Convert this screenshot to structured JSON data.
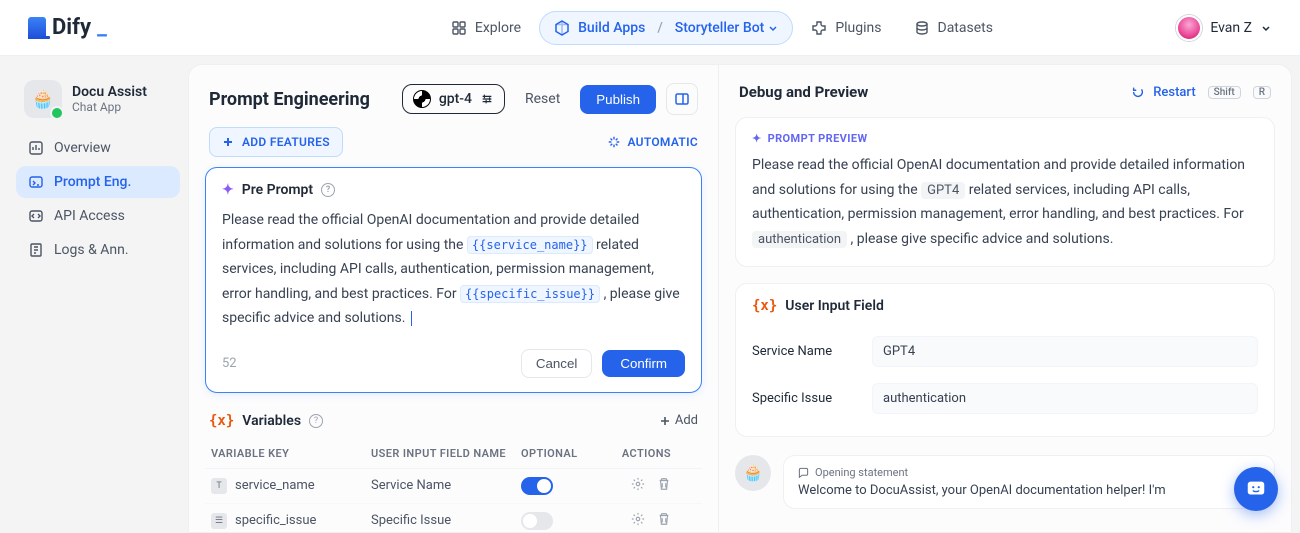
{
  "brand": "Dify",
  "nav": {
    "explore": "Explore",
    "build": "Build Apps",
    "bot": "Storyteller Bot",
    "plugins": "Plugins",
    "datasets": "Datasets"
  },
  "user": {
    "name": "Evan Z"
  },
  "app": {
    "name": "Docu Assist",
    "type": "Chat App",
    "emoji": "🧁"
  },
  "sidebar": {
    "items": [
      {
        "label": "Overview"
      },
      {
        "label": "Prompt Eng."
      },
      {
        "label": "API Access"
      },
      {
        "label": "Logs & Ann."
      }
    ]
  },
  "page": {
    "title": "Prompt Engineering",
    "model": "gpt-4",
    "reset": "Reset",
    "publish": "Publish"
  },
  "features": {
    "add": "ADD FEATURES",
    "auto": "AUTOMATIC"
  },
  "preprompt": {
    "title": "Pre Prompt",
    "text_a": "Please read the official OpenAI documentation and provide detailed information and solutions for using the ",
    "var_a": "{{service_name}}",
    "text_b": " related services, including API calls, authentication, permission management, error handling, and best practices. For ",
    "var_b": "{{specific_issue}}",
    "text_c": " , please give specific advice and solutions. ",
    "count": "52",
    "cancel": "Cancel",
    "confirm": "Confirm"
  },
  "variables": {
    "title": "Variables",
    "icon": "{x}",
    "add": "Add",
    "headers": {
      "key": "VARIABLE KEY",
      "name": "USER INPUT FIELD NAME",
      "optional": "OPTIONAL",
      "actions": "ACTIONS"
    },
    "rows": [
      {
        "key": "service_name",
        "name": "Service Name",
        "optional": true
      },
      {
        "key": "specific_issue",
        "name": "Specific Issue",
        "optional": false
      }
    ]
  },
  "debug": {
    "title": "Debug and Preview",
    "restart": "Restart",
    "kbd1": "Shift",
    "kbd2": "R",
    "preview_label": "PROMPT PREVIEW",
    "preview_a": "Please read the official OpenAI documentation and provide detailed information and solutions for using the ",
    "val_a": "GPT4",
    "preview_b": " related services, including API calls, authentication, permission management, error handling, and best practices. For ",
    "val_b": "authentication",
    "preview_c": " , please give specific advice and solutions.",
    "input_title": "User Input Field",
    "fields": [
      {
        "label": "Service Name",
        "value": "GPT4"
      },
      {
        "label": "Specific Issue",
        "value": "authentication"
      }
    ],
    "opening_label": "Opening statement",
    "opening_text": "Welcome to DocuAssist, your OpenAI documentation helper! I'm"
  }
}
